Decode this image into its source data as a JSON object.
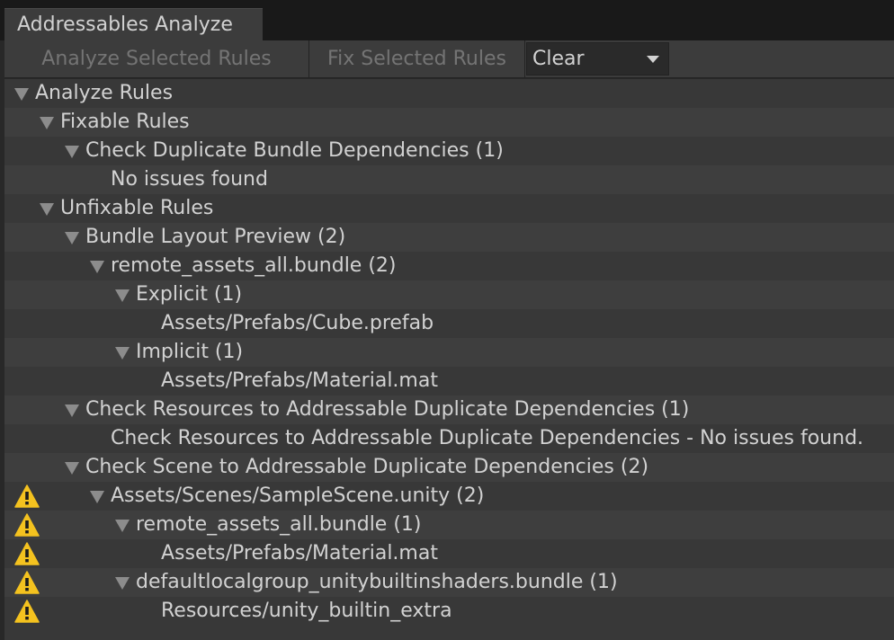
{
  "tab": {
    "label": "Addressables Analyze"
  },
  "toolbar": {
    "analyze_label": "Analyze Selected Rules",
    "fix_label": "Fix Selected Rules",
    "clear_value": "Clear"
  },
  "tree": [
    {
      "label": "Analyze Rules",
      "depth": 0,
      "expanded": true,
      "warning": false
    },
    {
      "label": "Fixable Rules",
      "depth": 1,
      "expanded": true,
      "warning": false
    },
    {
      "label": "Check Duplicate Bundle Dependencies (1)",
      "depth": 2,
      "expanded": true,
      "warning": false
    },
    {
      "label": "No issues found",
      "depth": 3,
      "expanded": false,
      "warning": false
    },
    {
      "label": "Unfixable Rules",
      "depth": 1,
      "expanded": true,
      "warning": false
    },
    {
      "label": "Bundle Layout Preview (2)",
      "depth": 2,
      "expanded": true,
      "warning": false
    },
    {
      "label": "remote_assets_all.bundle (2)",
      "depth": 3,
      "expanded": true,
      "warning": false
    },
    {
      "label": "Explicit (1)",
      "depth": 4,
      "expanded": true,
      "warning": false
    },
    {
      "label": "Assets/Prefabs/Cube.prefab",
      "depth": 5,
      "expanded": false,
      "warning": false
    },
    {
      "label": "Implicit (1)",
      "depth": 4,
      "expanded": true,
      "warning": false
    },
    {
      "label": "Assets/Prefabs/Material.mat",
      "depth": 5,
      "expanded": false,
      "warning": false
    },
    {
      "label": "Check Resources to Addressable Duplicate Dependencies (1)",
      "depth": 2,
      "expanded": true,
      "warning": false
    },
    {
      "label": "Check Resources to Addressable Duplicate Dependencies - No issues found.",
      "depth": 3,
      "expanded": false,
      "warning": false
    },
    {
      "label": "Check Scene to Addressable Duplicate Dependencies (2)",
      "depth": 2,
      "expanded": true,
      "warning": false
    },
    {
      "label": "Assets/Scenes/SampleScene.unity (2)",
      "depth": 3,
      "expanded": true,
      "warning": true
    },
    {
      "label": "remote_assets_all.bundle (1)",
      "depth": 4,
      "expanded": true,
      "warning": true
    },
    {
      "label": "Assets/Prefabs/Material.mat",
      "depth": 5,
      "expanded": false,
      "warning": true
    },
    {
      "label": "defaultlocalgroup_unitybuiltinshaders.bundle (1)",
      "depth": 4,
      "expanded": true,
      "warning": true
    },
    {
      "label": "Resources/unity_builtin_extra",
      "depth": 5,
      "expanded": false,
      "warning": true
    }
  ],
  "colors": {
    "warning": "#f4c21f",
    "background": "#383838",
    "row_alt": "#3e3e3e"
  }
}
